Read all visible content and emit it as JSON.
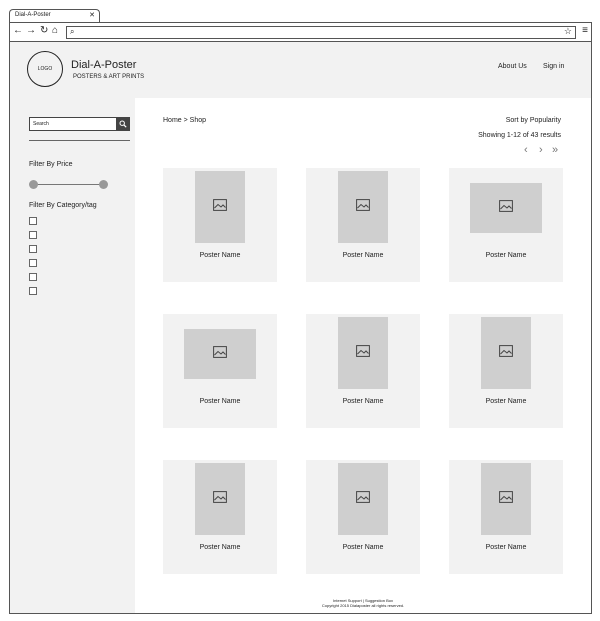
{
  "browser": {
    "tab_title": "Dial-A-Poster",
    "tab_close": "✕",
    "icons": {
      "back": "←",
      "forward": "→",
      "reload": "↻",
      "home": "⌂",
      "menu": "≡",
      "star": "☆",
      "search": "⌕"
    }
  },
  "header": {
    "logo": "LOGO",
    "title": "Dial-A-Poster",
    "subtitle": "POSTERS & ART PRINTS",
    "nav": {
      "about": "About Us",
      "signin": "Sign in"
    }
  },
  "sidebar": {
    "search_placeholder": "Search",
    "filter_price": "Filter By Price",
    "price_range": [
      0,
      1
    ],
    "filter_category": "Filter By Category/tag",
    "category_count": 6
  },
  "content": {
    "breadcrumb": "Home > Shop",
    "sort": "Sort by Popularity",
    "results": "Showing 1-12 of 43 results",
    "pager": {
      "prev": "‹",
      "next": "›",
      "last": "»"
    }
  },
  "products": [
    {
      "name": "Poster Name",
      "orientation": "portrait"
    },
    {
      "name": "Poster Name",
      "orientation": "portrait"
    },
    {
      "name": "Poster Name",
      "orientation": "landscape"
    },
    {
      "name": "Poster Name",
      "orientation": "landscape"
    },
    {
      "name": "Poster Name",
      "orientation": "portrait"
    },
    {
      "name": "Poster Name",
      "orientation": "portrait"
    },
    {
      "name": "Poster Name",
      "orientation": "portrait"
    },
    {
      "name": "Poster Name",
      "orientation": "portrait"
    },
    {
      "name": "Poster Name",
      "orientation": "portrait"
    }
  ],
  "footer": {
    "links": "Internet Support | Suggestion Box",
    "copyright": "Copyright 2015 Dialaposter all rights reserved."
  }
}
